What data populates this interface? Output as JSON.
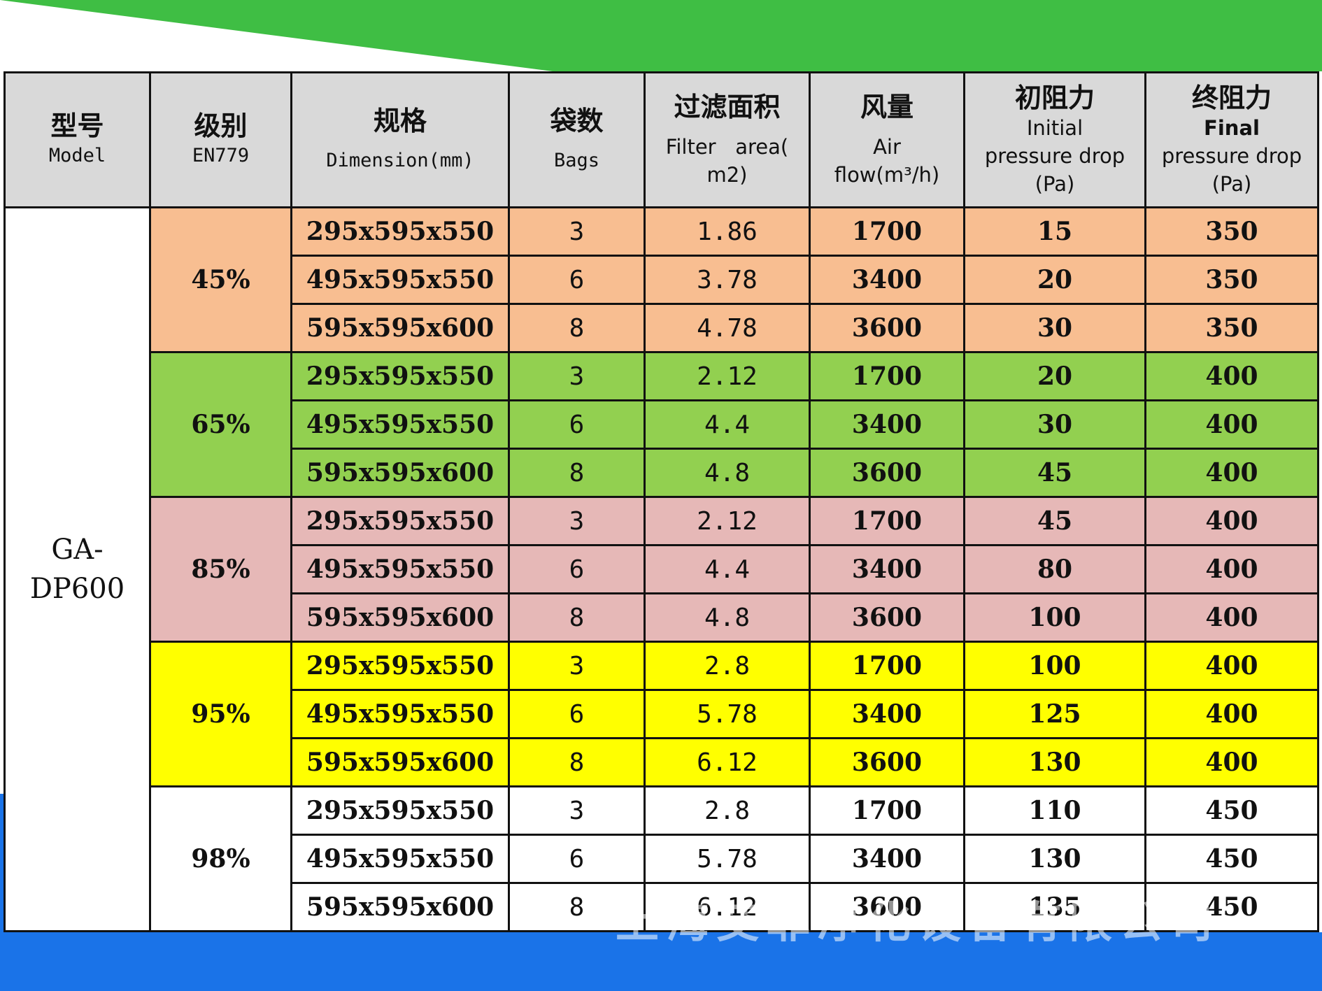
{
  "header": {
    "model": {
      "cn": "型号",
      "en": "Model"
    },
    "grade": {
      "cn": "级别",
      "en": "EN779"
    },
    "dimension": {
      "cn": "规格",
      "en": "Dimension(mm)"
    },
    "bags": {
      "cn": "袋数",
      "en": "Bags"
    },
    "area": {
      "cn": "过滤面积",
      "en1": "Filter   area(",
      "en2": "m2)"
    },
    "airflow": {
      "cn": "风量",
      "en1": "Air",
      "en2": "flow(m³/h)"
    },
    "initial": {
      "cn": "初阻力",
      "en1": "Initial",
      "en2": "pressure drop",
      "en3": "(Pa)"
    },
    "final": {
      "cn": "终阻力",
      "en1": "Final",
      "en2": "pressure drop",
      "en3": "(Pa)"
    }
  },
  "model_name": {
    "line1": "GA-",
    "line2": "DP600"
  },
  "groups": [
    {
      "grade": "45%",
      "color": "#f8be91",
      "rows": [
        {
          "dim": "295x595x550",
          "bags": "3",
          "area": "1.86",
          "airflow": "1700",
          "initial": "15",
          "final": "350"
        },
        {
          "dim": "495x595x550",
          "bags": "6",
          "area": "3.78",
          "airflow": "3400",
          "initial": "20",
          "final": "350"
        },
        {
          "dim": "595x595x600",
          "bags": "8",
          "area": "4.78",
          "airflow": "3600",
          "initial": "30",
          "final": "350"
        }
      ]
    },
    {
      "grade": "65%",
      "color": "#92d050",
      "rows": [
        {
          "dim": "295x595x550",
          "bags": "3",
          "area": "2.12",
          "airflow": "1700",
          "initial": "20",
          "final": "400"
        },
        {
          "dim": "495x595x550",
          "bags": "6",
          "area": "4.4",
          "airflow": "3400",
          "initial": "30",
          "final": "400"
        },
        {
          "dim": "595x595x600",
          "bags": "8",
          "area": "4.8",
          "airflow": "3600",
          "initial": "45",
          "final": "400"
        }
      ]
    },
    {
      "grade": "85%",
      "color": "#e6b8b7",
      "rows": [
        {
          "dim": "295x595x550",
          "bags": "3",
          "area": "2.12",
          "airflow": "1700",
          "initial": "45",
          "final": "400"
        },
        {
          "dim": "495x595x550",
          "bags": "6",
          "area": "4.4",
          "airflow": "3400",
          "initial": "80",
          "final": "400"
        },
        {
          "dim": "595x595x600",
          "bags": "8",
          "area": "4.8",
          "airflow": "3600",
          "initial": "100",
          "final": "400"
        }
      ]
    },
    {
      "grade": "95%",
      "color": "#ffff00",
      "rows": [
        {
          "dim": "295x595x550",
          "bags": "3",
          "area": "2.8",
          "airflow": "1700",
          "initial": "100",
          "final": "400"
        },
        {
          "dim": "495x595x550",
          "bags": "6",
          "area": "5.78",
          "airflow": "3400",
          "initial": "125",
          "final": "400"
        },
        {
          "dim": "595x595x600",
          "bags": "8",
          "area": "6.12",
          "airflow": "3600",
          "initial": "130",
          "final": "400"
        }
      ]
    },
    {
      "grade": "98%",
      "color": "#ffffff",
      "rows": [
        {
          "dim": "295x595x550",
          "bags": "3",
          "area": "2.8",
          "airflow": "1700",
          "initial": "110",
          "final": "450"
        },
        {
          "dim": "495x595x550",
          "bags": "6",
          "area": "5.78",
          "airflow": "3400",
          "initial": "130",
          "final": "450"
        },
        {
          "dim": "595x595x600",
          "bags": "8",
          "area": "6.12",
          "airflow": "3600",
          "initial": "135",
          "final": "450"
        }
      ]
    }
  ],
  "watermark": "上海艾菲净化设备有限公司",
  "colors": {
    "top_band": "#3fbe44",
    "bottom_band": "#1a73e8"
  }
}
